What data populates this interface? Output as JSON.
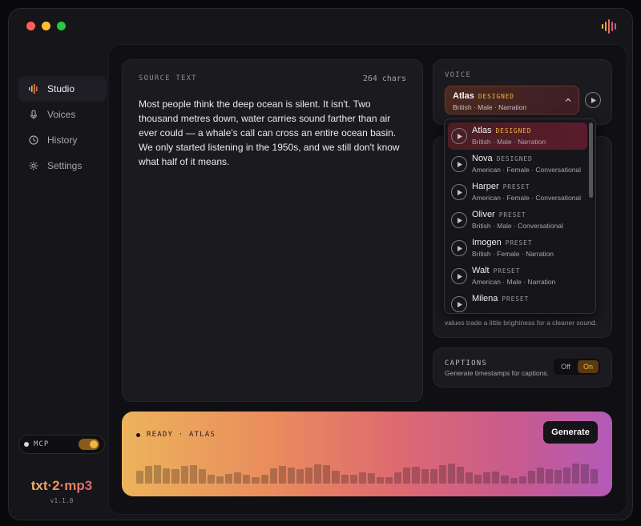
{
  "sidebar": {
    "items": [
      {
        "label": "Studio",
        "icon": "waveform-icon",
        "active": true
      },
      {
        "label": "Voices",
        "icon": "mic-icon",
        "active": false
      },
      {
        "label": "History",
        "icon": "clock-icon",
        "active": false
      },
      {
        "label": "Settings",
        "icon": "gear-icon",
        "active": false
      }
    ],
    "mcp_label": "MCP",
    "mcp_enabled": true,
    "brand": "txt·2·mp3",
    "version": "v1.1.8"
  },
  "source": {
    "label": "SOURCE TEXT",
    "count": "264 chars",
    "text": "Most people think the deep ocean is silent. It isn't. Two thousand metres down, water carries sound farther than air ever could — a whale's call can cross an entire ocean basin. We only started listening in the 1950s, and we still don't know what half of it means."
  },
  "voice": {
    "label": "VOICE",
    "selected": {
      "name": "Atlas",
      "tag": "DESIGNED",
      "sub": "British · Male · Narration"
    },
    "options": [
      {
        "name": "Atlas",
        "tag": "DESIGNED",
        "sub": "British · Male · Narration",
        "selected": true
      },
      {
        "name": "Nova",
        "tag": "DESIGNED",
        "sub": "American · Female · Conversational",
        "selected": false
      },
      {
        "name": "Harper",
        "tag": "PRESET",
        "sub": "American · Female · Conversational",
        "selected": false
      },
      {
        "name": "Oliver",
        "tag": "PRESET",
        "sub": "British · Male · Conversational",
        "selected": false
      },
      {
        "name": "Imogen",
        "tag": "PRESET",
        "sub": "British · Female · Narration",
        "selected": false
      },
      {
        "name": "Walt",
        "tag": "PRESET",
        "sub": "American · Male · Narration",
        "selected": false
      },
      {
        "name": "Milena",
        "tag": "PRESET",
        "sub": "",
        "selected": false
      }
    ],
    "filter_text_visible": "values trade a little brightness for a cleaner sound."
  },
  "captions": {
    "label": "CAPTIONS",
    "sub": "Generate timestamps for captions.",
    "off_label": "Off",
    "on_label": "On",
    "value": "On"
  },
  "generate": {
    "status": "READY · ATLAS",
    "button": "Generate"
  },
  "colors": {
    "accent": "#f2b543",
    "selected_bg": "#4a1e22",
    "panel": "#1b1a1f"
  }
}
